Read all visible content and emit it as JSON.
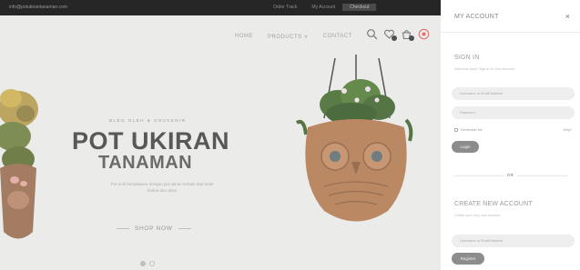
{
  "topbar": {
    "email": "info@potukirantanaman.com",
    "links": [
      "Order Track",
      "My Account",
      "Checkout"
    ]
  },
  "nav": {
    "items": [
      "HOME",
      "PRODUCTS ∨",
      "CONTACT"
    ]
  },
  "hero": {
    "subtitle": "BLEG OLEH & SOUVENIR",
    "title_line1": "POT UKIRAN",
    "title_line2": "TANAMAN",
    "description": "Pot unik bersatwane dengan pot ukiran terbaik dari hotel kedua dan desa",
    "cta": "SHOP NOW"
  },
  "panel": {
    "title": "MY ACCOUNT",
    "close": "×",
    "signin": {
      "title": "SIGN IN",
      "subtitle": "Welcome back! Sign in to Your Account",
      "username_placeholder": "Username or Email Address",
      "password_placeholder": "Password",
      "remember": "Remember Me",
      "forgot": "Help?",
      "login_label": "Login"
    },
    "or_label": "OR",
    "register": {
      "title": "CREATE NEW ACCOUNT",
      "subtitle": "Create your very own account",
      "email_placeholder": "Username or Email Address",
      "register_label": "Register"
    }
  },
  "colors": {
    "topbar_bg": "#262626",
    "page_bg": "#f1f1ef",
    "button_bg": "#8c8c8c",
    "accent_red": "#e06060"
  }
}
